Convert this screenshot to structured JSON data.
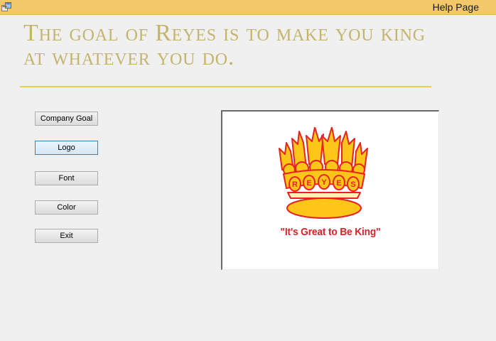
{
  "window": {
    "title": "Help Page",
    "titlebar_color": "#f2c86b",
    "icon": "winforms-app-icon"
  },
  "heading": {
    "text": "The goal of Reyes is to make you king at whatever you do.",
    "color": "#c4b46c",
    "divider_color": "#f2cf39"
  },
  "buttons": [
    {
      "label": "Company Goal",
      "focused": false
    },
    {
      "label": "Logo",
      "focused": true
    },
    {
      "label": "Font",
      "focused": false
    },
    {
      "label": "Color",
      "focused": false
    },
    {
      "label": "Exit",
      "focused": false
    }
  ],
  "logo": {
    "crown_letters": "REYES",
    "slogan": "\"It's Great to Be King\"",
    "crown_color": "#ffc61a",
    "outline_color": "#e8231f",
    "slogan_color": "#d8232a",
    "icon": "reyes-crown-logo"
  }
}
